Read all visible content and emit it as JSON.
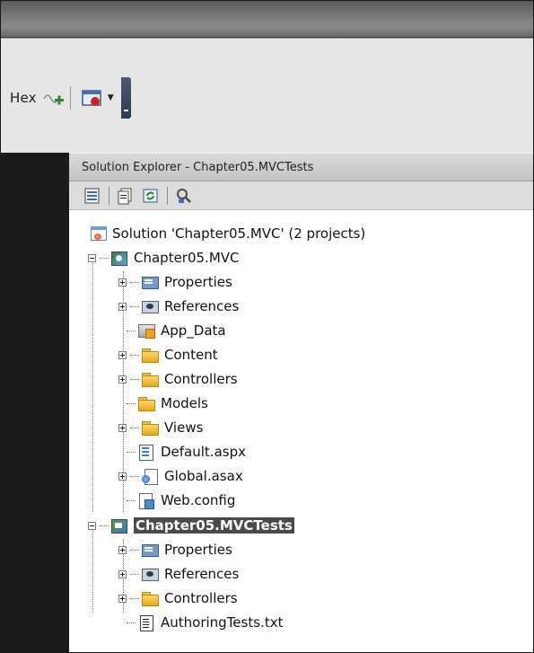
{
  "toolbar": {
    "hex_label": "Hex"
  },
  "solution_explorer": {
    "title": "Solution Explorer - Chapter05.MVCTests",
    "tree": {
      "solution_label": "Solution 'Chapter05.MVC' (2 projects)",
      "project1": {
        "label": "Chapter05.MVC",
        "items": {
          "properties": "Properties",
          "references": "References",
          "app_data": "App_Data",
          "content": "Content",
          "controllers": "Controllers",
          "models": "Models",
          "views": "Views",
          "default_aspx": "Default.aspx",
          "global_asax": "Global.asax",
          "web_config": "Web.config"
        }
      },
      "project2": {
        "label": "Chapter05.MVCTests",
        "items": {
          "properties": "Properties",
          "references": "References",
          "controllers": "Controllers",
          "authoring_tests": "AuthoringTests.txt"
        }
      }
    }
  },
  "colors": {
    "selection_bg": "#4a4a4a",
    "folder": "#f0c14a",
    "panel_header": "#d0d0d0"
  }
}
